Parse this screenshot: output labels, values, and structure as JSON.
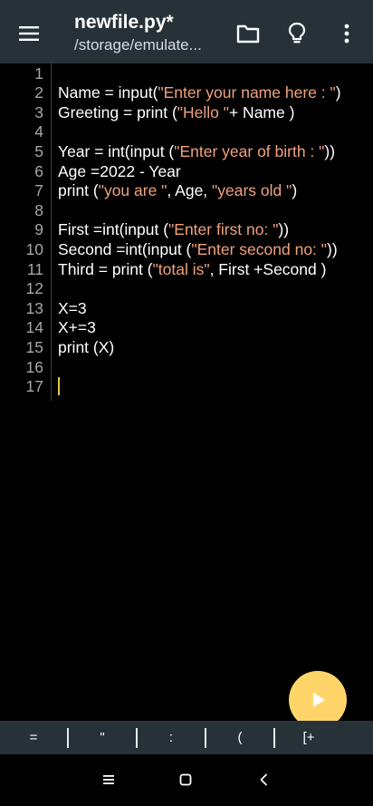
{
  "appbar": {
    "title": "newfile.py*",
    "subtitle": "/storage/emulate...",
    "icons": [
      "hamburger-menu-icon",
      "folder-icon",
      "lightbulb-icon",
      "more-vert-icon"
    ],
    "color": "#263238"
  },
  "editor": {
    "lines": [
      {
        "n": "1",
        "code": "",
        "str": ""
      },
      {
        "n": "2",
        "code": "Name = input(",
        "str": "\"Enter your name here : \"",
        "tail": ")"
      },
      {
        "n": "3",
        "code": "Greeting = print (",
        "str": "\"Hello \"",
        "tail": "+ Name )"
      },
      {
        "n": "4",
        "code": "",
        "str": ""
      },
      {
        "n": "5",
        "code": "Year = int(input (",
        "str": "\"Enter year of birth : \"",
        "tail": "))"
      },
      {
        "n": "6",
        "code": "Age =2022 - Year",
        "str": ""
      },
      {
        "n": "7",
        "code": "print (",
        "str": "\"you are \"",
        "tail": ", Age, ",
        "str2": "\"years old \"",
        "tail2": ")"
      },
      {
        "n": "8",
        "code": "",
        "str": ""
      },
      {
        "n": "9",
        "code": "First =int(input (",
        "str": "\"Enter first no: \"",
        "tail": "))"
      },
      {
        "n": "10",
        "code": "Second =int(input (",
        "str": "\"Enter second no: \"",
        "tail": "))"
      },
      {
        "n": "11",
        "code": "Third = print (",
        "str": "\"total is\"",
        "tail": ", First +Second )"
      },
      {
        "n": "12",
        "code": "",
        "str": ""
      },
      {
        "n": "13",
        "code": "X=3",
        "str": ""
      },
      {
        "n": "14",
        "code": "X+=3",
        "str": ""
      },
      {
        "n": "15",
        "code": "print (X)",
        "str": ""
      },
      {
        "n": "16",
        "code": "",
        "str": ""
      },
      {
        "n": "17",
        "code": "",
        "str": "",
        "cursor": true
      }
    ],
    "string_color": "#f0a27e",
    "cursor_color": "#e6c84a"
  },
  "fab": {
    "icon": "play-icon",
    "color": "#ffd56a"
  },
  "symbols": [
    "=",
    "\"",
    ":",
    "(",
    "[+"
  ],
  "sysnav": {
    "icons": [
      "recent-apps-icon",
      "home-icon",
      "back-icon"
    ]
  }
}
